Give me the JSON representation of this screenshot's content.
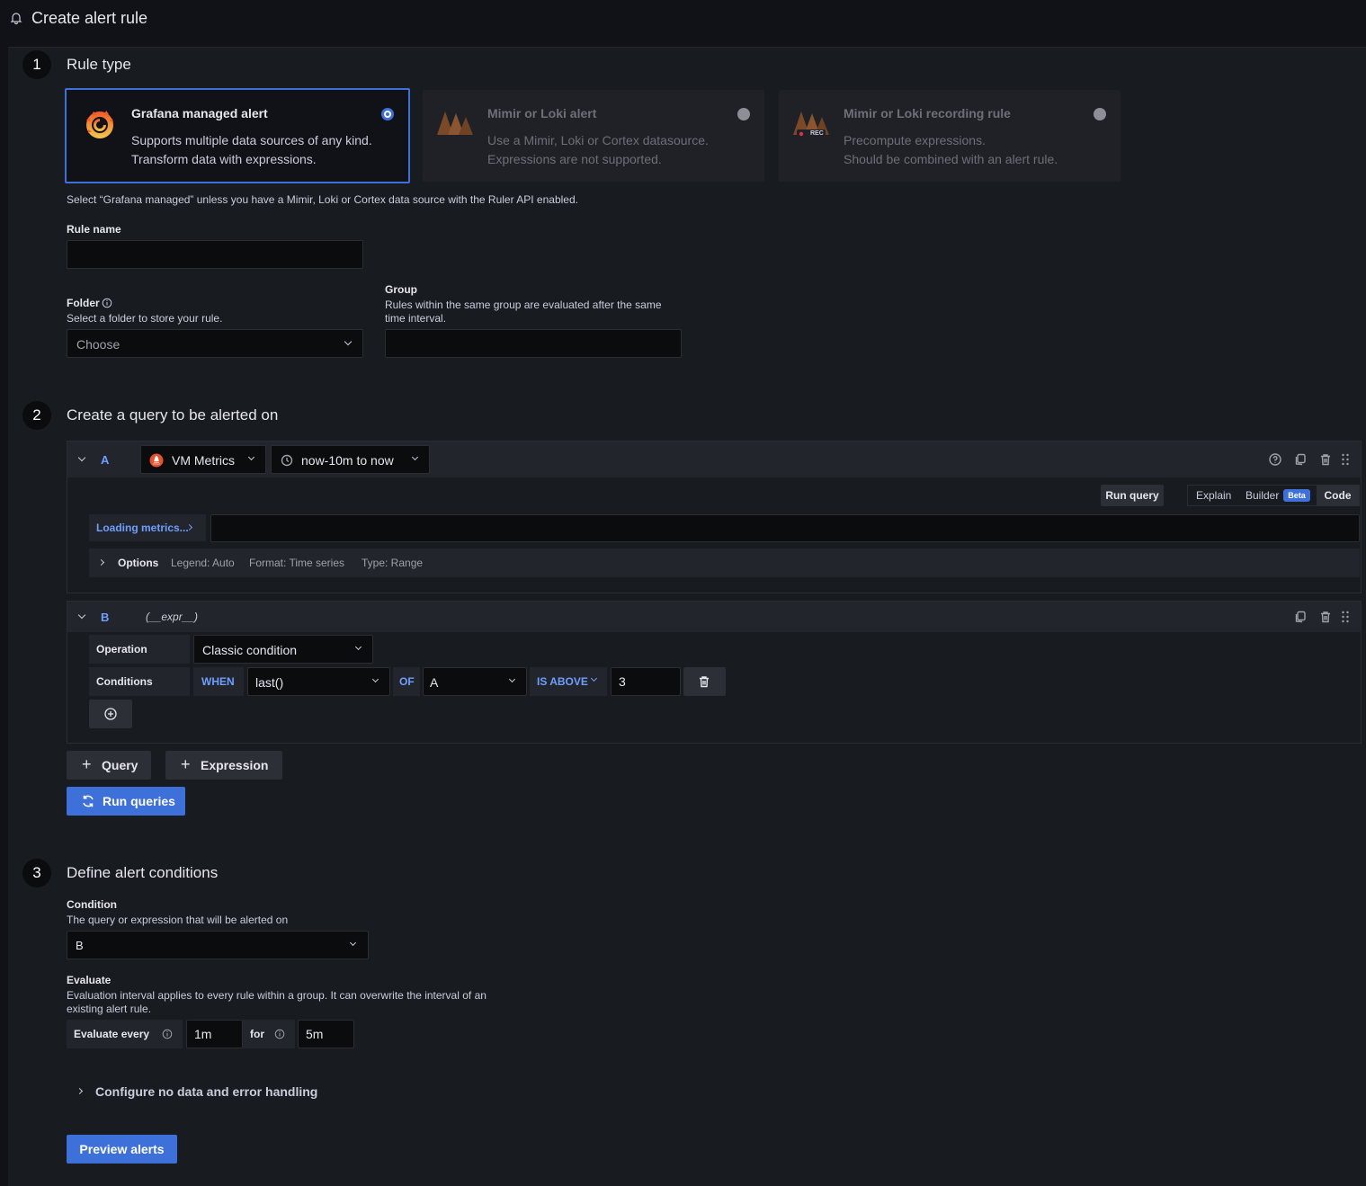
{
  "header": {
    "title": "Create alert rule"
  },
  "step1": {
    "number": "1",
    "title": "Rule type",
    "cards": [
      {
        "title": "Grafana managed alert",
        "desc1": "Supports multiple data sources of any kind.",
        "desc2": "Transform data with expressions.",
        "selected": true
      },
      {
        "title": "Mimir or Loki alert",
        "desc1": "Use a Mimir, Loki or Cortex datasource.",
        "desc2": "Expressions are not supported.",
        "selected": false
      },
      {
        "title": "Mimir or Loki recording rule",
        "desc1": "Precompute expressions.",
        "desc2": "Should be combined with an alert rule.",
        "selected": false,
        "badge": "REC"
      }
    ],
    "hint": "Select “Grafana managed” unless you have a Mimir, Loki or Cortex data source with the Ruler API enabled.",
    "rule_name_label": "Rule name",
    "rule_name_value": "",
    "folder_label": "Folder",
    "folder_desc": "Select a folder to store your rule.",
    "folder_placeholder": "Choose",
    "group_label": "Group",
    "group_desc1": "Rules within the same group are evaluated after the same",
    "group_desc2": "time interval.",
    "group_value": ""
  },
  "step2": {
    "number": "2",
    "title": "Create a query to be alerted on",
    "queryA": {
      "label": "A",
      "datasource": "VM Metrics",
      "timerange": "now-10m to now",
      "run_query": "Run query",
      "modes": [
        "Explain",
        "Builder",
        "Code"
      ],
      "beta": "Beta",
      "metrics_button": "Loading metrics...",
      "options_label": "Options",
      "legend": "Legend: Auto",
      "format": "Format: Time series",
      "type": "Type: Range"
    },
    "queryB": {
      "label": "B",
      "expr": "(__expr__)",
      "operation_label": "Operation",
      "operation_value": "Classic condition",
      "conditions_label": "Conditions",
      "when": "WHEN",
      "func": "last()",
      "of": "OF",
      "of_value": "A",
      "is_above": "IS ABOVE",
      "threshold": "3"
    },
    "add_query": "Query",
    "add_expression": "Expression",
    "run_queries": "Run queries"
  },
  "step3": {
    "number": "3",
    "title": "Define alert conditions",
    "condition_label": "Condition",
    "condition_desc": "The query or expression that will be alerted on",
    "condition_value": "B",
    "evaluate_label": "Evaluate",
    "evaluate_desc1": "Evaluation interval applies to every rule within a group. It can overwrite the interval of an",
    "evaluate_desc2": "existing alert rule.",
    "evaluate_every_label": "Evaluate every",
    "evaluate_every_value": "1m",
    "for_label": "for",
    "for_value": "5m",
    "no_data_toggle": "Configure no data and error handling",
    "preview": "Preview alerts"
  },
  "colors": {
    "accent": "#3d71d9",
    "background": "#111217",
    "panel": "#181b1f",
    "keyword": "#6e9fff"
  }
}
